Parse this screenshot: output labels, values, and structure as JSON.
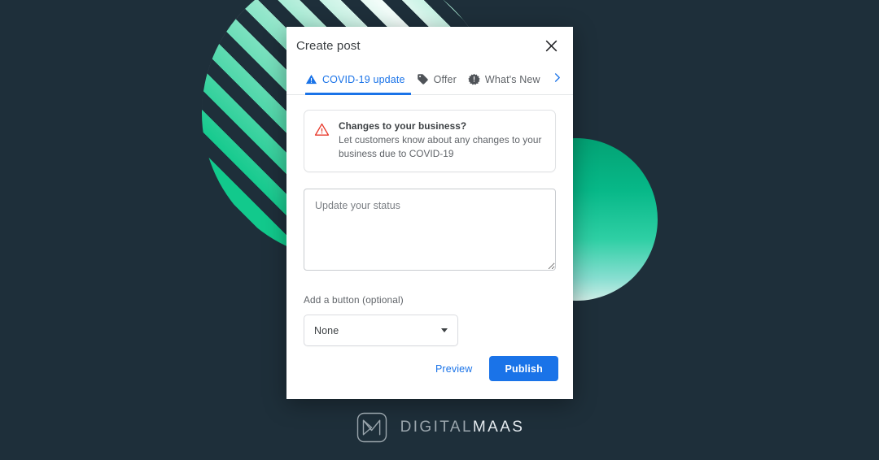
{
  "background": {
    "color": "#1e2f3a",
    "striped_circle_color": "#12c98c",
    "solid_circle_gradient_from": "#03a274",
    "solid_circle_gradient_to": "#cfeee7"
  },
  "modal": {
    "title": "Create post",
    "close_icon": "close-icon",
    "tabs": [
      {
        "label": "COVID-19 update",
        "icon": "warning-triangle-icon",
        "active": true
      },
      {
        "label": "Offer",
        "icon": "tag-icon",
        "active": false
      },
      {
        "label": "What's New",
        "icon": "burst-exclamation-icon",
        "active": false
      }
    ],
    "tabs_next_icon": "chevron-right-icon",
    "alert": {
      "icon": "warning-triangle-outline-icon",
      "title": "Changes to your business?",
      "description": "Let customers know about any changes to your business due to COVID-19"
    },
    "status_field": {
      "placeholder": "Update your status",
      "value": ""
    },
    "button_field": {
      "label": "Add a button (optional)",
      "selected": "None",
      "caret_icon": "chevron-down-icon"
    },
    "footer": {
      "preview_label": "Preview",
      "publish_label": "Publish",
      "publish_color": "#1a73e8"
    }
  },
  "brand": {
    "mark": "digitalmaas-monogram-icon",
    "name_part1": "DIGITAL",
    "name_part2": "MAAS"
  }
}
